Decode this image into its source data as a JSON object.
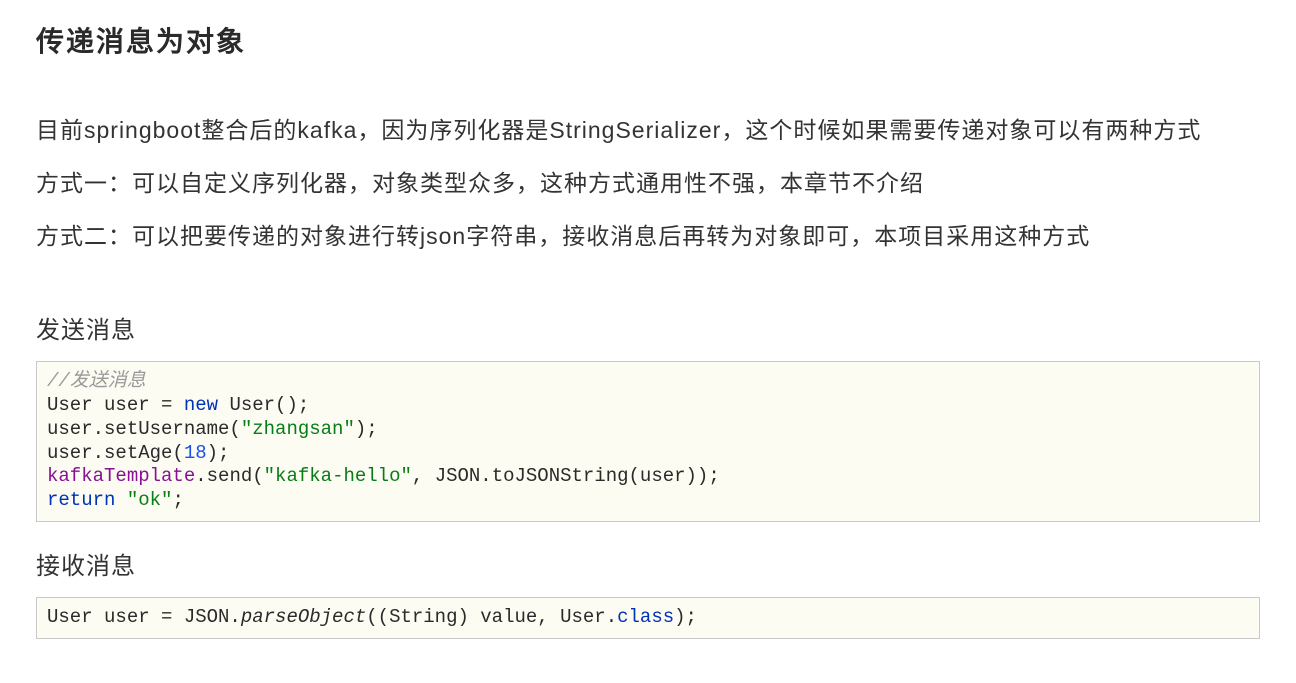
{
  "heading": "传递消息为对象",
  "paragraphs": {
    "p1": "目前springboot整合后的kafka，因为序列化器是StringSerializer，这个时候如果需要传递对象可以有两种方式",
    "p2": "方式一：可以自定义序列化器，对象类型众多，这种方式通用性不强，本章节不介绍",
    "p3": "方式二：可以把要传递的对象进行转json字符串，接收消息后再转为对象即可，本项目采用这种方式"
  },
  "sections": {
    "send": {
      "title": "发送消息",
      "code": {
        "comment": "//发送消息",
        "l2a": "User user = ",
        "l2_keyword": "new",
        "l2b": " User();",
        "l3a": "user.setUsername(",
        "l3_str": "\"zhangsan\"",
        "l3b": ");",
        "l4a": "user.setAge(",
        "l4_num": "18",
        "l4b": ");",
        "l5_var": "kafkaTemplate",
        "l5a": ".send(",
        "l5_str1": "\"kafka-hello\"",
        "l5b": ", JSON.toJSONString(user));",
        "l6_kw": "return",
        "l6_sp": " ",
        "l6_str": "\"ok\"",
        "l6b": ";"
      }
    },
    "receive": {
      "title": "接收消息",
      "code": {
        "l1a": "User user = JSON.",
        "l1_ital": "parseObject",
        "l1b": "((String) value, User.",
        "l1_kw": "class",
        "l1c": ");"
      }
    }
  }
}
